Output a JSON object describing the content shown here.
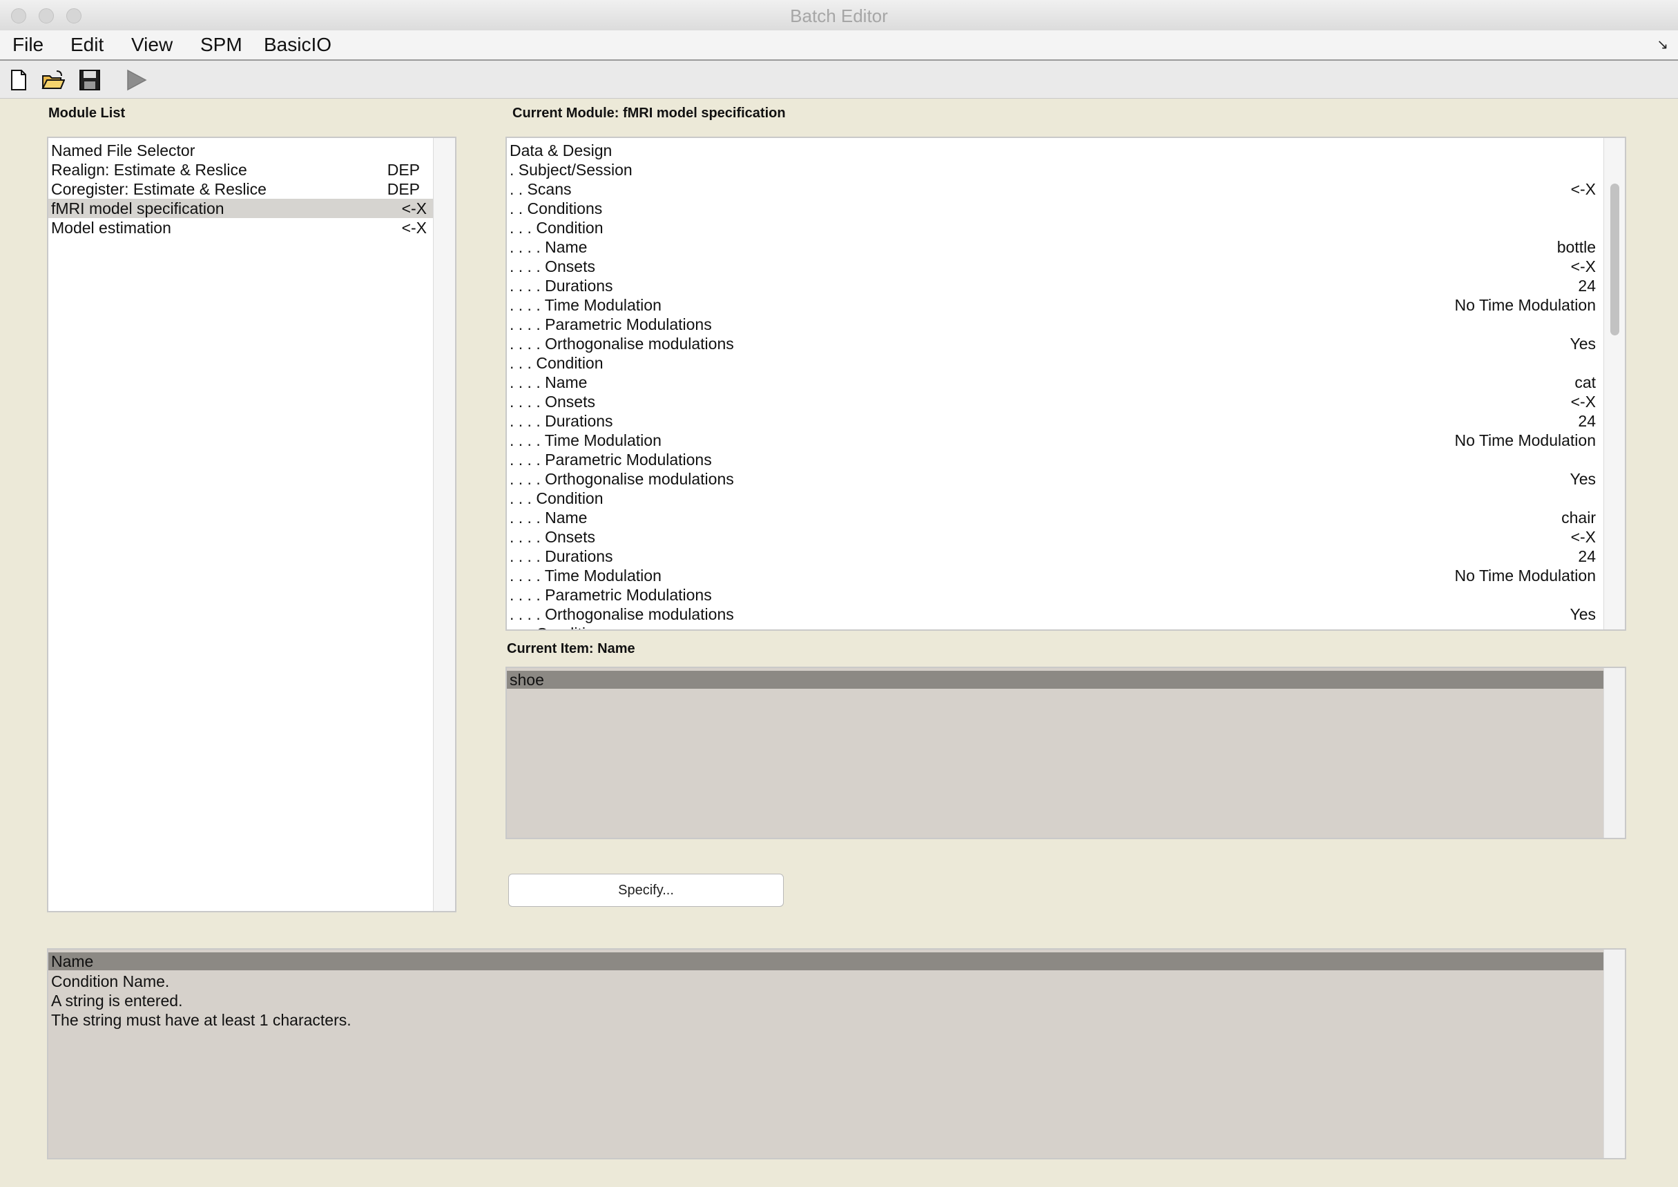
{
  "window": {
    "title": "Batch Editor"
  },
  "menu": [
    "File",
    "Edit",
    "View",
    "SPM",
    "BasicIO"
  ],
  "toolbar": {
    "icons": [
      "new-file-icon",
      "open-folder-icon",
      "save-icon",
      "run-icon"
    ]
  },
  "module_list": {
    "label": "Module List",
    "items": [
      {
        "name": "Named File Selector",
        "status": ""
      },
      {
        "name": "Realign: Estimate & Reslice",
        "status": "DEP"
      },
      {
        "name": "Coregister: Estimate & Reslice",
        "status": "DEP"
      },
      {
        "name": "fMRI model specification",
        "status": "<-X"
      },
      {
        "name": "Model estimation",
        "status": "<-X"
      }
    ]
  },
  "current_module": {
    "label": "Current Module: fMRI model specification",
    "rows": [
      {
        "label": "Data & Design",
        "value": ""
      },
      {
        "label": ". Subject/Session",
        "value": ""
      },
      {
        "label": ". . Scans",
        "value": "<-X"
      },
      {
        "label": ". . Conditions",
        "value": ""
      },
      {
        "label": ". . . Condition",
        "value": ""
      },
      {
        "label": ". . . . Name",
        "value": "bottle"
      },
      {
        "label": ". . . . Onsets",
        "value": "<-X"
      },
      {
        "label": ". . . . Durations",
        "value": "24"
      },
      {
        "label": ". . . . Time Modulation",
        "value": "No Time Modulation"
      },
      {
        "label": ". . . . Parametric Modulations",
        "value": ""
      },
      {
        "label": ". . . . Orthogonalise modulations",
        "value": "Yes"
      },
      {
        "label": ". . . Condition",
        "value": ""
      },
      {
        "label": ". . . . Name",
        "value": "cat"
      },
      {
        "label": ". . . . Onsets",
        "value": "<-X"
      },
      {
        "label": ". . . . Durations",
        "value": "24"
      },
      {
        "label": ". . . . Time Modulation",
        "value": "No Time Modulation"
      },
      {
        "label": ". . . . Parametric Modulations",
        "value": ""
      },
      {
        "label": ". . . . Orthogonalise modulations",
        "value": "Yes"
      },
      {
        "label": ". . . Condition",
        "value": ""
      },
      {
        "label": ". . . . Name",
        "value": "chair"
      },
      {
        "label": ". . . . Onsets",
        "value": "<-X"
      },
      {
        "label": ". . . . Durations",
        "value": "24"
      },
      {
        "label": ". . . . Time Modulation",
        "value": "No Time Modulation"
      },
      {
        "label": ". . . . Parametric Modulations",
        "value": ""
      },
      {
        "label": ". . . . Orthogonalise modulations",
        "value": "Yes"
      },
      {
        "label": ". . . Condition",
        "value": ""
      }
    ]
  },
  "current_item": {
    "label": "Current Item: Name",
    "value": "shoe"
  },
  "specify_button": "Specify...",
  "help": {
    "lines": [
      "Name",
      "Condition Name.",
      "A string is entered.",
      "The string must have at least 1 characters."
    ]
  }
}
